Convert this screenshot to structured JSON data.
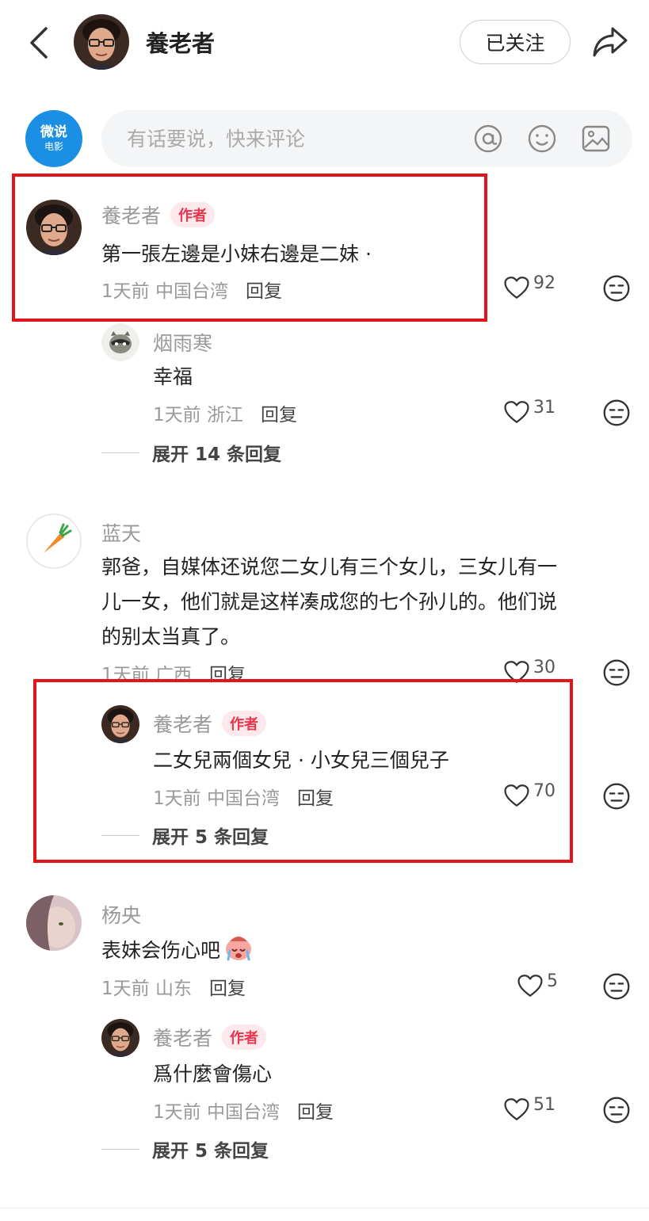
{
  "header": {
    "back_icon": "chevron-left-icon",
    "author_name": "養老者",
    "follow_label": "已关注",
    "share_icon": "share-icon"
  },
  "comment_bar": {
    "brand_line1": "微说",
    "brand_line2": "电影",
    "placeholder": "有话要说，快来评论",
    "icons": [
      "at-icon",
      "emoji-icon",
      "image-icon"
    ]
  },
  "reply_label": "回复",
  "author_badge": "作者",
  "comments": [
    {
      "name": "養老者",
      "badge": true,
      "text": "第一張左邊是小妹右邊是二妹 ·",
      "time": "1天前",
      "location": "中国台湾",
      "likes": "92"
    },
    {
      "name": "烟雨寒",
      "badge": false,
      "text": "幸福",
      "time": "1天前",
      "location": "浙江",
      "likes": "31",
      "expand": "展开 14 条回复"
    },
    {
      "name": "蓝天",
      "badge": false,
      "text_lines": [
        "郭爸，自媒体还说您二女儿有三个女儿，三女儿有一",
        "儿一女，他们就是这样凑成您的七个孙儿的。他们说",
        "的别太当真了。"
      ],
      "time": "1天前",
      "location": "广西",
      "likes": "30"
    },
    {
      "name": "養老者",
      "badge": true,
      "text": "二女兒兩個女兒 · 小女兒三個兒子",
      "time": "1天前",
      "location": "中国台湾",
      "likes": "70",
      "expand": "展开 5 条回复"
    },
    {
      "name": "杨央",
      "badge": false,
      "text": "表妹会伤心吧",
      "time": "1天前",
      "location": "山东",
      "likes": "5"
    },
    {
      "name": "養老者",
      "badge": true,
      "text": "爲什麼會傷心",
      "time": "1天前",
      "location": "中国台湾",
      "likes": "51",
      "expand": "展开 5 条回复"
    }
  ],
  "colors": {
    "highlight_box": "#e1151b",
    "author_badge": "#e8364f",
    "brand": "#1a8fe3"
  }
}
